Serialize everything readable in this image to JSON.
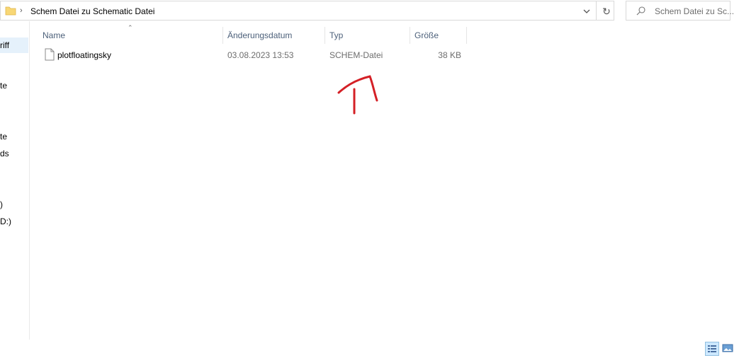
{
  "address": {
    "path": "Schem Datei zu Schematic Datei",
    "icons": {
      "folder": "folder-icon",
      "chevron": "chevron-right-icon",
      "dropdown": "chevron-down-icon",
      "refresh": "refresh-icon"
    }
  },
  "search": {
    "placeholder": "Schem Datei zu Sc..."
  },
  "nav": {
    "items": [
      {
        "label": "riff",
        "selected": true
      },
      {
        "label": "te"
      },
      {
        "label": "te"
      },
      {
        "label": "ds"
      },
      {
        "label": ")"
      },
      {
        "label": "D:)"
      }
    ]
  },
  "columns": {
    "name": "Name",
    "date": "Änderungsdatum",
    "type": "Typ",
    "size": "Größe"
  },
  "files": [
    {
      "name": "plotfloatingsky",
      "date": "03.08.2023 13:53",
      "type": "SCHEM-Datei",
      "size": "38 KB"
    }
  ],
  "colors": {
    "header_text": "#4c607a",
    "annotation": "#d42026",
    "selection": "#e5f1fb"
  }
}
